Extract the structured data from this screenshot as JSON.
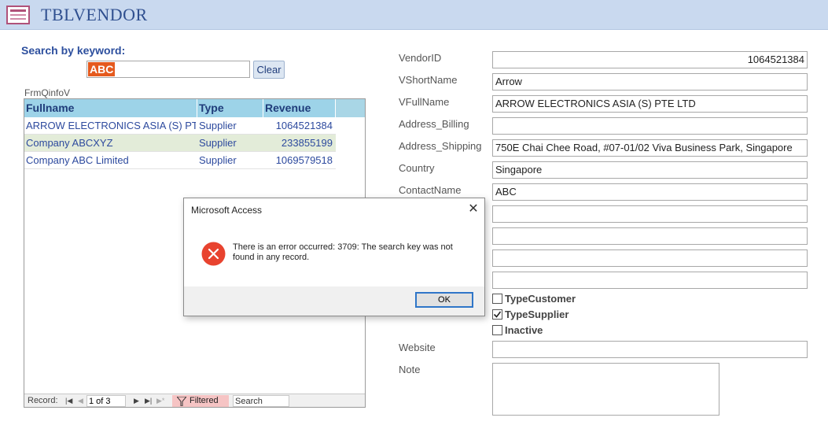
{
  "header": {
    "title": "TBLVENDOR",
    "icon": "form-icon"
  },
  "search": {
    "label": "Search by keyword:",
    "value": "ABC",
    "clear_label": "Clear"
  },
  "subform": {
    "caption": "FrmQinfoV",
    "columns": [
      "Fullname",
      "Type",
      "Revenue"
    ],
    "rows": [
      {
        "fullname": "ARROW ELECTRONICS ASIA (S) PTE L",
        "type": "Supplier",
        "revenue": "1064521384"
      },
      {
        "fullname": "Company ABCXYZ",
        "type": "Supplier",
        "revenue": "233855199"
      },
      {
        "fullname": "Company ABC Limited",
        "type": "Supplier",
        "revenue": "1069579518"
      }
    ],
    "selected_row_color": "#e3ecd9",
    "nav": {
      "record_label": "Record:",
      "current": "1 of 3",
      "first_icon": "first-record-icon",
      "prev_icon": "prev-record-icon",
      "next_icon": "next-record-icon",
      "last_icon": "last-record-icon",
      "filtered_label": "Filtered",
      "search_placeholder": "Search"
    }
  },
  "fields": {
    "vendor_id": {
      "label": "VendorID",
      "value": "1064521384"
    },
    "vshort_name": {
      "label": "VShortName",
      "value": "Arrow"
    },
    "vfull_name": {
      "label": "VFullName",
      "value": "ARROW ELECTRONICS ASIA (S) PTE LTD"
    },
    "address_billing": {
      "label": "Address_Billing",
      "value": ""
    },
    "address_shipping": {
      "label": "Address_Shipping",
      "value": "750E Chai Chee Road, #07-01/02 Viva Business Park, Singapore"
    },
    "country": {
      "label": "Country",
      "value": "Singapore"
    },
    "contact_name": {
      "label": "ContactName",
      "value": "ABC"
    },
    "extra1": {
      "value": ""
    },
    "extra2": {
      "value": ""
    },
    "extra3": {
      "value": ""
    },
    "extra4": {
      "value": ""
    },
    "website": {
      "label": "Website",
      "value": ""
    },
    "note": {
      "label": "Note",
      "value": ""
    }
  },
  "checkboxes": [
    {
      "label": "TypeCustomer",
      "checked": false
    },
    {
      "label": "TypeSupplier",
      "checked": true
    },
    {
      "label": "Inactive",
      "checked": false
    }
  ],
  "dialog": {
    "title": "Microsoft Access",
    "message": "There is an error occurred: 3709: The search key was not found in any record.",
    "ok_label": "OK",
    "icon": "error-icon",
    "close_icon": "close-icon"
  },
  "colors": {
    "header_bg": "#c9d9ef",
    "title_text": "#2f4f8f",
    "grid_header_bg": "#9dd3e8",
    "selection": "#e55a1e",
    "error_red": "#e8432f"
  }
}
